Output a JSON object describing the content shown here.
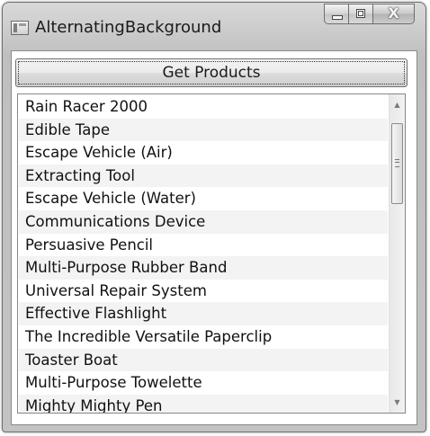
{
  "window": {
    "title": "AlternatingBackground",
    "icons": {
      "app": "application-icon",
      "minimize": "minimize-icon",
      "maximize": "maximize-icon",
      "close": "close-icon"
    },
    "close_glyph": "X",
    "chrome_color": "#c3c3c3"
  },
  "toolbar": {
    "get_products_label": "Get Products"
  },
  "products": {
    "items": [
      "Rain Racer 2000",
      "Edible Tape",
      "Escape Vehicle (Air)",
      "Extracting Tool",
      "Escape Vehicle (Water)",
      "Communications Device",
      "Persuasive Pencil",
      "Multi-Purpose Rubber Band",
      "Universal Repair System",
      "Effective Flashlight",
      "The Incredible Versatile Paperclip",
      "Toaster Boat",
      "Multi-Purpose Towelette",
      "Mighty Mighty Pen"
    ],
    "alternate_row_color": "#f3f3f3",
    "scrollbar": {
      "up_arrow": "▲",
      "down_arrow": "▼",
      "icons": {
        "up": "scroll-up-arrow-icon",
        "down": "scroll-down-arrow-icon",
        "grip": "scroll-grip-icon"
      }
    }
  }
}
